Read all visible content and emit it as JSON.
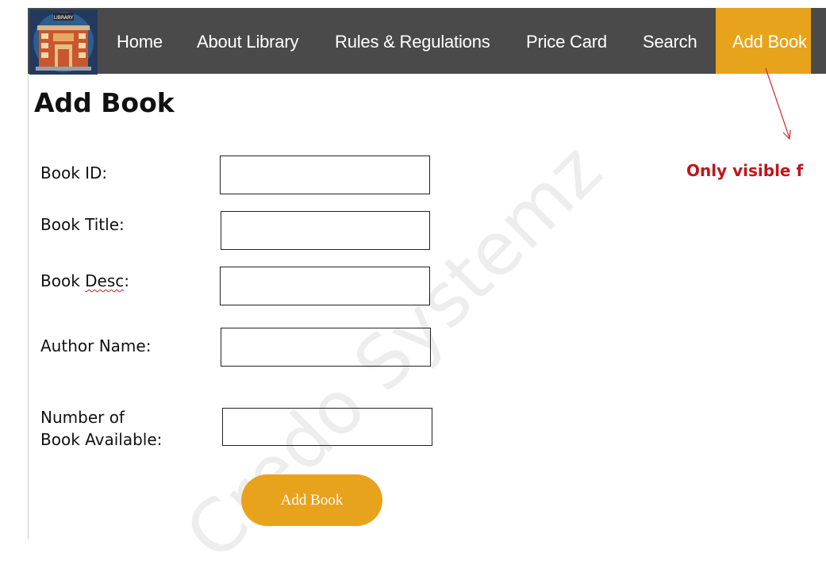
{
  "nav": {
    "logo_text": "LIBRARY",
    "items": [
      {
        "label": "Home"
      },
      {
        "label": "About Library"
      },
      {
        "label": "Rules & Regulations"
      },
      {
        "label": "Price Card"
      },
      {
        "label": "Search"
      },
      {
        "label": "Add Book",
        "active": true
      }
    ],
    "active_color": "#e8a31c",
    "bar_color": "#4a4a4a"
  },
  "page": {
    "title": "Add Book"
  },
  "form": {
    "fields": [
      {
        "label": "Book ID:",
        "value": ""
      },
      {
        "label_main": "Book ",
        "label_marked": "Desc",
        "label_end": ":"
      },
      {
        "label": "Book Title:",
        "value": ""
      },
      {
        "label": "Author Name:",
        "value": ""
      },
      {
        "label_line1": "Number of",
        "label_line2": "Book Available:",
        "value": ""
      }
    ],
    "submit_label": "Add Book"
  },
  "annotation": {
    "text": "Only visible f",
    "color": "#c0151b"
  },
  "watermark": {
    "text": "Credo Systemz"
  }
}
